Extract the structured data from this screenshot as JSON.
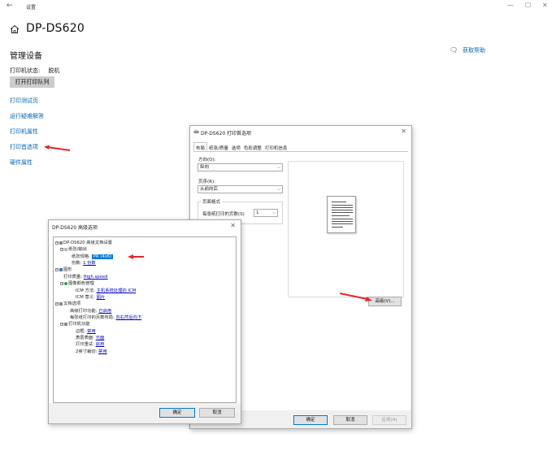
{
  "window": {
    "back_glyph": "←",
    "title": "设置",
    "minimize_glyph": "—",
    "maximize_glyph": "☐",
    "close_glyph": "✕"
  },
  "page": {
    "title": "DP-DS620",
    "section": "管理设备",
    "status_label": "打印机状态:",
    "status_value": "脱机",
    "queue_button": "打开打印队列",
    "links": [
      "打印测试页",
      "运行疑难解答",
      "打印机属性",
      "打印首选项",
      "硬件属性"
    ],
    "help": "获取帮助",
    "help_icon": "chat-icon"
  },
  "preferences_dialog": {
    "title": "DP-DS620 打印首选项",
    "close_glyph": "✕",
    "tabs": [
      "布局",
      "纸张/质量",
      "选项",
      "色彩调整",
      "打印机信息"
    ],
    "orientation_label": "方向(O):",
    "orientation_value": "纵向",
    "page_order_label": "页序(R):",
    "page_order_value": "从前向后",
    "page_format_label": "页面格式",
    "pages_per_sheet_label": "每张纸打印的页数(S)",
    "pages_per_sheet_value": "1",
    "advanced_button": "高级(V)...",
    "ok": "确定",
    "cancel": "取消",
    "apply": "应用(A)"
  },
  "advanced_dialog": {
    "title": "DP-DS620 高级选项",
    "close_glyph": "✕",
    "tree": {
      "root": "DP-DS620 高级文档设置",
      "paper_output": "纸张/输出",
      "paper_size_label": "纸张规格:",
      "paper_size_value": "PR (4x6)",
      "copies_label": "份数:",
      "copies_value": "1 份数",
      "graphic": "图形",
      "print_quality_label": "打印质量:",
      "print_quality_value": "High speed",
      "icm_group": "图像颜色管理",
      "icm_method_label": "ICM 方法:",
      "icm_method_value": "主机系统处理的 ICM",
      "icm_intent_label": "ICM 意义:",
      "icm_intent_value": "图片",
      "doc_options": "文档选项",
      "adv_print_label": "高级打印功能:",
      "adv_print_value": "已启用",
      "pages_layout_label": "每张纸打印的页数布局:",
      "pages_layout_value": "向右然后向下",
      "printer_features": "打印机功能",
      "border_label": "边框:",
      "border_value": "禁用",
      "surface_label": "表层表面:",
      "surface_value": "光面",
      "print_mode_label": "打印重试:",
      "print_mode_value": "启用",
      "cut_label": "2英寸裁切:",
      "cut_value": "禁用"
    },
    "ok": "确定",
    "cancel": "取消"
  },
  "colors": {
    "link": "#0067b8",
    "annotation_arrow": "#e8262a",
    "selection": "#0078d7"
  }
}
